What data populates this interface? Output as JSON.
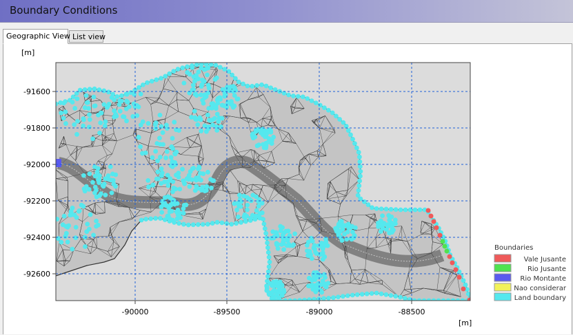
{
  "window": {
    "title": "Boundary Conditions"
  },
  "tabs": [
    {
      "label": "Geographic View",
      "active": true
    },
    {
      "label": "List view",
      "active": false
    }
  ],
  "map": {
    "x_unit": "[m]",
    "y_unit": "[m]",
    "x_ticks": [
      "-90000",
      "-89500",
      "-89000",
      "-88500"
    ],
    "y_ticks": [
      "-91600",
      "-91800",
      "-92000",
      "-92200",
      "-92400",
      "-92600"
    ],
    "background": "#dcdcdc",
    "grid_color": "#1e5fd8",
    "mesh_color": "#3a3a3a"
  },
  "legend": {
    "title": "Boundaries",
    "items": [
      {
        "label": "Vale Jusante",
        "color": "#ef5a5a"
      },
      {
        "label": "Rio Jusante",
        "color": "#4fe24f"
      },
      {
        "label": "Rio Montante",
        "color": "#5a5aef"
      },
      {
        "label": "Nao considerar",
        "color": "#f2f25a"
      },
      {
        "label": "Land boundary",
        "color": "#55e8ee"
      }
    ]
  }
}
